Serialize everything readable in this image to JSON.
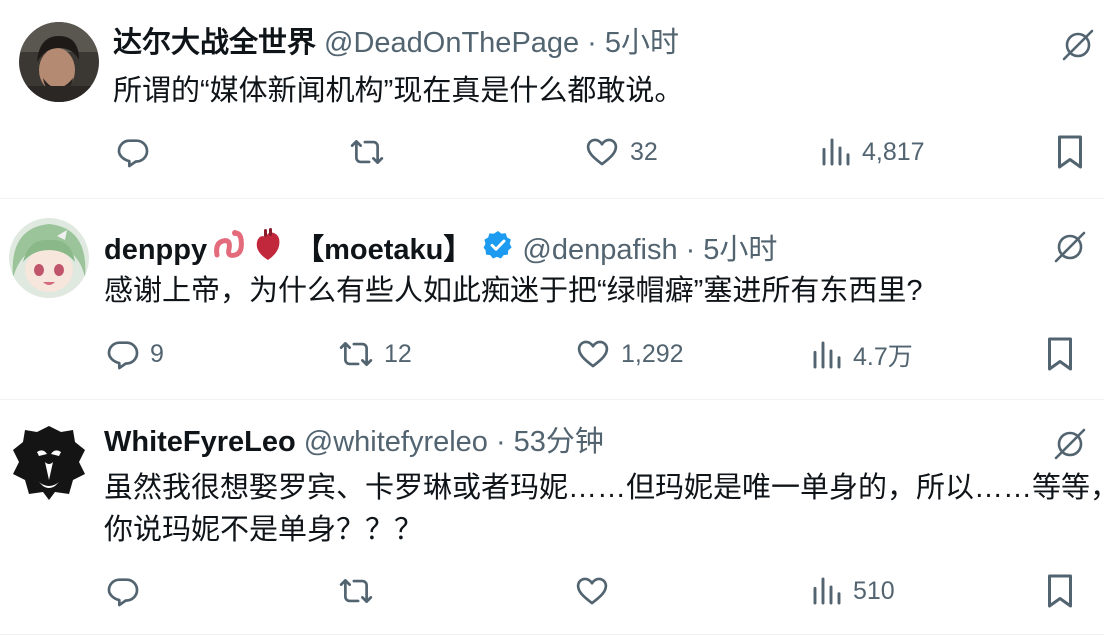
{
  "tweets": [
    {
      "name": "达尔大战全世界",
      "handle": "@DeadOnThePage",
      "separator": "·",
      "time": "5小时",
      "lines": [
        "所谓的“媒体新闻机构”现在真是什么都敢说。"
      ],
      "replies": "",
      "retweets": "",
      "likes": "32",
      "views": "4,817"
    },
    {
      "name": "denppy",
      "name_suffix": "【moetaku】",
      "handle": "@denpafish",
      "separator": "·",
      "time": "5小时",
      "lines": [
        "感谢上帝，为什么有些人如此痴迷于把“绿帽癖”塞进所有东西里?"
      ],
      "replies": "9",
      "retweets": "12",
      "likes": "1,292",
      "views": "4.7万"
    },
    {
      "name": "WhiteFyreLeo",
      "handle": "@whitefyreleo",
      "separator": "·",
      "time": "53分钟",
      "lines": [
        "虽然我很想娶罗宾、卡罗琳或者玛妮……但玛妮是唯一单身的，所以……等等，",
        "你说玛妮不是单身？？？"
      ],
      "replies": "",
      "retweets": "",
      "likes": "",
      "views": "510"
    }
  ],
  "icons": {
    "reply": "reply-icon",
    "retweet": "retweet-icon",
    "like": "heart-icon",
    "views": "views-icon",
    "bookmark": "bookmark-icon",
    "grok": "grok-icon",
    "verified": "verified-badge-icon"
  },
  "colors": {
    "text": "#0f1419",
    "secondary": "#536471",
    "verified": "#1d9bf0",
    "divider": "#eff3f4"
  }
}
